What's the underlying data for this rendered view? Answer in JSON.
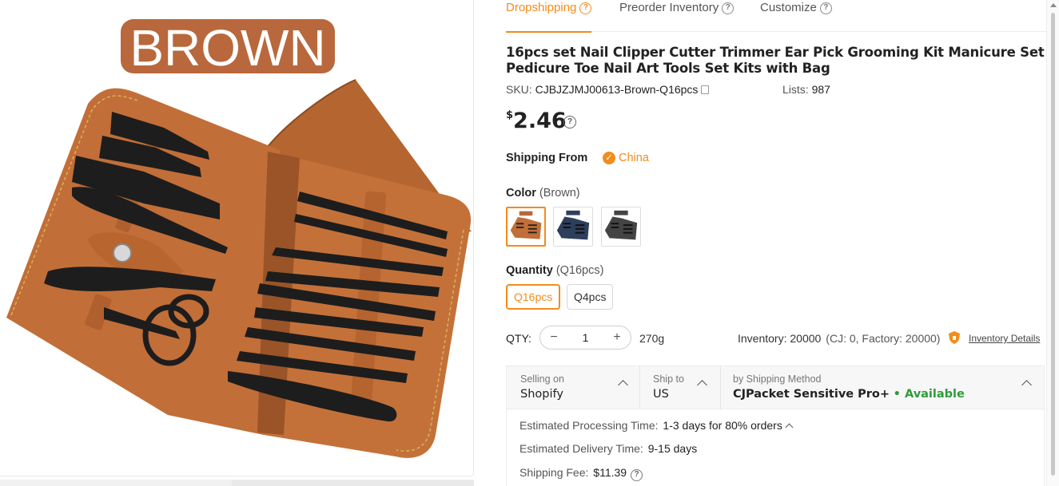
{
  "product_image": {
    "overlay_label": "BROWN",
    "colors": {
      "label_bg": "#b8683c",
      "leather": "#c26e38",
      "leather_dark": "#9a5428",
      "tools": "#1e1e1e"
    }
  },
  "tabs": [
    {
      "label": "Dropshipping",
      "active": true
    },
    {
      "label": "Preorder Inventory",
      "active": false
    },
    {
      "label": "Customize",
      "active": false
    }
  ],
  "product": {
    "title": "16pcs set Nail Clipper Cutter Trimmer Ear Pick Grooming Kit Manicure Set Pedicure Toe Nail Art Tools Set Kits with Bag",
    "sku_label": "SKU:",
    "sku": "CJBJZJMJ00613-Brown-Q16pcs",
    "lists_label": "Lists:",
    "lists": "987",
    "price_currency": "$",
    "price": "2.46"
  },
  "shipping_from": {
    "label": "Shipping From",
    "value": "China"
  },
  "color": {
    "label": "Color",
    "selected": "(Brown)",
    "swatches": [
      {
        "name": "Brown",
        "tag": "BROWN",
        "hex": "#c26e38",
        "selected": true
      },
      {
        "name": "Blue",
        "tag": "BLUE",
        "hex": "#2e3f5c",
        "selected": false
      },
      {
        "name": "Grey",
        "tag": "GREY",
        "hex": "#444444",
        "selected": false
      }
    ]
  },
  "quantity": {
    "label": "Quantity",
    "selected": "(Q16pcs)",
    "options": [
      {
        "label": "Q16pcs",
        "selected": true
      },
      {
        "label": "Q4pcs",
        "selected": false
      }
    ]
  },
  "qty": {
    "label": "QTY:",
    "minus": "−",
    "plus": "+",
    "value": "1",
    "weight": "270g",
    "inventory": "Inventory: 20000",
    "inventory_detail": "(CJ: 0, Factory: 20000)",
    "details_link": "Inventory Details"
  },
  "shipping": {
    "selling_on_label": "Selling on",
    "selling_on": "Shopify",
    "ship_to_label": "Ship to",
    "ship_to": "US",
    "method_label": "by Shipping Method",
    "method": "CJPacket Sensitive Pro+",
    "availability": "• Available",
    "processing_label": "Estimated Processing Time:",
    "processing": "1-3 days for 80% orders",
    "delivery_label": "Estimated Delivery Time:",
    "delivery": "9-15 days",
    "fee_label": "Shipping Fee:",
    "fee": "$11.39"
  },
  "accent_color": "#f28c1c",
  "available_color": "#2e9b3a"
}
